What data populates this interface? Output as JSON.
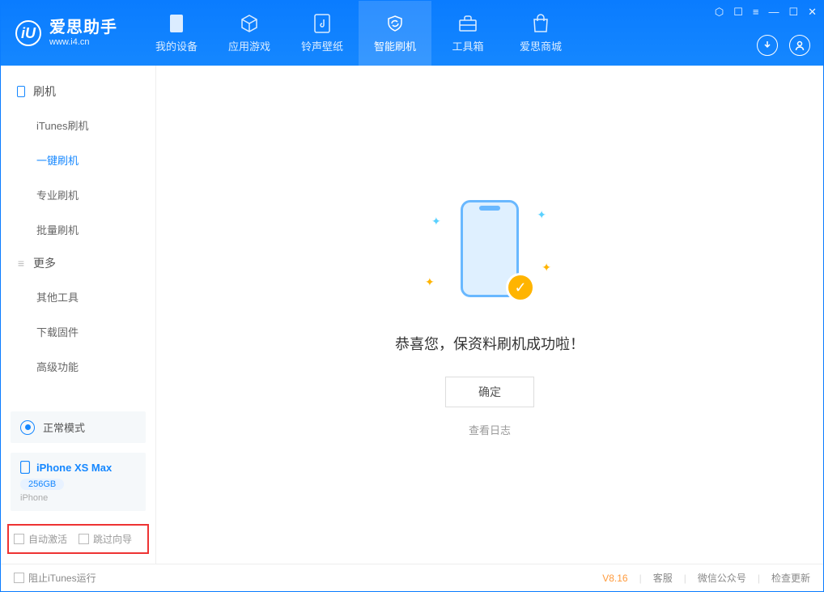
{
  "app": {
    "title": "爱思助手",
    "subtitle": "www.i4.cn"
  },
  "nav": {
    "my_device": "我的设备",
    "apps_games": "应用游戏",
    "ring_wall": "铃声壁纸",
    "smart_flash": "智能刷机",
    "toolbox": "工具箱",
    "store": "爱思商城"
  },
  "sidebar": {
    "sec_flash": "刷机",
    "items_flash": {
      "itunes": "iTunes刷机",
      "onekey": "一键刷机",
      "pro": "专业刷机",
      "batch": "批量刷机"
    },
    "sec_more": "更多",
    "items_more": {
      "other": "其他工具",
      "firmware": "下载固件",
      "advanced": "高级功能"
    },
    "mode": "正常模式",
    "device": {
      "name": "iPhone XS Max",
      "capacity": "256GB",
      "type": "iPhone"
    },
    "cb_auto_activate": "自动激活",
    "cb_skip_guide": "跳过向导"
  },
  "main": {
    "success": "恭喜您，保资料刷机成功啦！",
    "ok": "确定",
    "view_log": "查看日志"
  },
  "footer": {
    "block_itunes": "阻止iTunes运行",
    "version": "V8.16",
    "support": "客服",
    "wechat": "微信公众号",
    "check_update": "检查更新"
  }
}
